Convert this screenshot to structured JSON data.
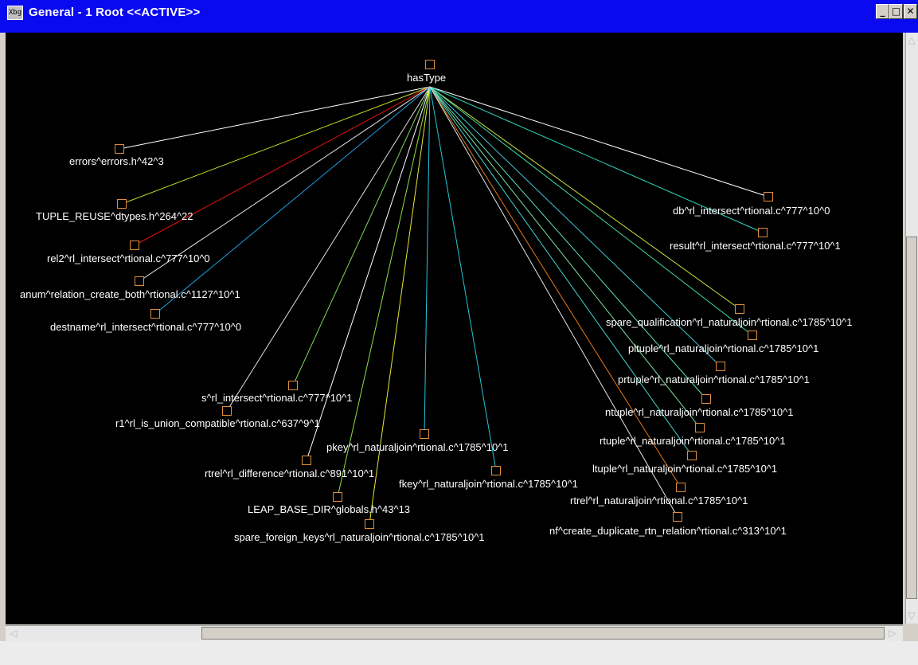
{
  "window": {
    "title": "General - 1 Root  <<ACTIVE>>",
    "icon": "app-logo-icon",
    "icon_text": "Xbg",
    "buttons": {
      "minimize": "_",
      "maximize": "□",
      "close": "✕"
    }
  },
  "graph": {
    "root": {
      "label": "hasType"
    },
    "nodes": [
      {
        "label": "errors^errors.h^42^3",
        "edge_color": "#ffffff"
      },
      {
        "label": "TUPLE_REUSE^dtypes.h^264^22",
        "edge_color": "#c8e020"
      },
      {
        "label": "rel2^rl_intersect^rtional.c^777^10^0",
        "edge_color": "#e01010"
      },
      {
        "label": "anum^relation_create_both^rtional.c^1127^10^1",
        "edge_color": "#e8e8e8"
      },
      {
        "label": "destname^rl_intersect^rtional.c^777^10^0",
        "edge_color": "#1ea0e8"
      },
      {
        "label": "s^rl_intersect^rtional.c^777^10^1",
        "edge_color": "#80d860"
      },
      {
        "label": "r1^rl_is_union_compatible^rtional.c^637^9^1",
        "edge_color": "#e0e0e0"
      },
      {
        "label": "rtrel^rl_difference^rtional.c^891^10^1",
        "edge_color": "#ffffff"
      },
      {
        "label": "LEAP_BASE_DIR^globals.h^43^13",
        "edge_color": "#90e040"
      },
      {
        "label": "spare_foreign_keys^rl_naturaljoin^rtional.c^1785^10^1",
        "edge_color": "#e8e830"
      },
      {
        "label": "pkey^rl_naturaljoin^rtional.c^1785^10^1",
        "edge_color": "#20c8e0"
      },
      {
        "label": "fkey^rl_naturaljoin^rtional.c^1785^10^1",
        "edge_color": "#20c8d8"
      },
      {
        "label": "db^rl_intersect^rtional.c^777^10^0",
        "edge_color": "#ffffff"
      },
      {
        "label": "result^rl_intersect^rtional.c^777^10^1",
        "edge_color": "#30d8c0"
      },
      {
        "label": "spare_qualification^rl_naturaljoin^rtional.c^1785^10^1",
        "edge_color": "#c8e040"
      },
      {
        "label": "pltuple^rl_naturaljoin^rtional.c^1785^10^1",
        "edge_color": "#40d8a0"
      },
      {
        "label": "prtuple^rl_naturaljoin^rtional.c^1785^10^1",
        "edge_color": "#40c8d8"
      },
      {
        "label": "ntuple^rl_naturaljoin^rtional.c^1785^10^1",
        "edge_color": "#60e0c0"
      },
      {
        "label": "rtuple^rl_naturaljoin^rtional.c^1785^10^1",
        "edge_color": "#80e0a0"
      },
      {
        "label": "ltuple^rl_naturaljoin^rtional.c^1785^10^1",
        "edge_color": "#40d8d0"
      },
      {
        "label": "rtrel^rl_naturaljoin^rtional.c^1785^10^1",
        "edge_color": "#e87818"
      },
      {
        "label": "nf^create_duplicate_rtn_relation^rtional.c^313^10^1",
        "edge_color": "#e8e8e8"
      }
    ]
  }
}
